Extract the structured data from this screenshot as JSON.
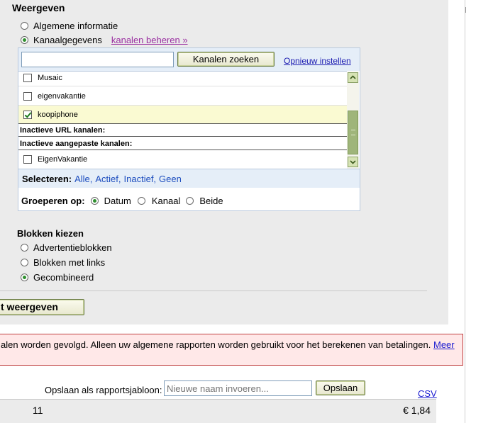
{
  "weergeven": {
    "heading": "Weergeven",
    "options": [
      {
        "label": "Algemene informatie",
        "selected": false
      },
      {
        "label": "Kanaalgegevens",
        "selected": true
      }
    ],
    "manage_link": "kanalen beheren »"
  },
  "channel_search": {
    "input_value": "",
    "search_button": "Kanalen zoeken",
    "reset_link": "Opnieuw instellen"
  },
  "channel_list": {
    "items": [
      {
        "label": "Musaic",
        "checked": false
      },
      {
        "label": "eigenvakantie",
        "checked": false
      },
      {
        "label": "koopiphone",
        "checked": true
      }
    ],
    "section_inactive_url": "Inactieve URL kanalen:",
    "section_inactive_custom": "Inactieve aangepaste kanalen:",
    "inactive_items": [
      {
        "label": "EigenVakantie",
        "checked": false
      }
    ]
  },
  "select_bar": {
    "label": "Selecteren:",
    "alle": "Alle,",
    "actief": "Actief,",
    "inactief": "Inactief,",
    "geen": "Geen"
  },
  "group_by": {
    "label": "Groeperen op:",
    "options": [
      {
        "label": "Datum",
        "selected": true
      },
      {
        "label": "Kanaal",
        "selected": false
      },
      {
        "label": "Beide",
        "selected": false
      }
    ]
  },
  "blokken": {
    "heading": "Blokken kiezen",
    "options": [
      {
        "label": "Advertentieblokken",
        "selected": false
      },
      {
        "label": "Blokken met links",
        "selected": false
      },
      {
        "label": "Gecombineerd",
        "selected": true
      }
    ]
  },
  "show_button": "t weergeven",
  "warning": {
    "text": "alen worden gevolgd. Alleen uw algemene rapporten worden gebruikt voor het berekenen van betalingen.",
    "link": "Meer"
  },
  "save_template": {
    "label": "Opslaan als rapportsjabloon:",
    "placeholder": "Nieuwe naam invoeren...",
    "button": "Opslaan",
    "csv_link": "CSV"
  },
  "summary_row": {
    "count": "11",
    "amount": "€ 1,84"
  },
  "colors": {
    "panel_bg": "#ebebeb",
    "highlight_row": "#fafad2",
    "select_bar_bg": "#e5eef8",
    "warning_bg": "#ffe8e8",
    "warning_border": "#c04040",
    "radio_dot": "#2f8f2f"
  }
}
